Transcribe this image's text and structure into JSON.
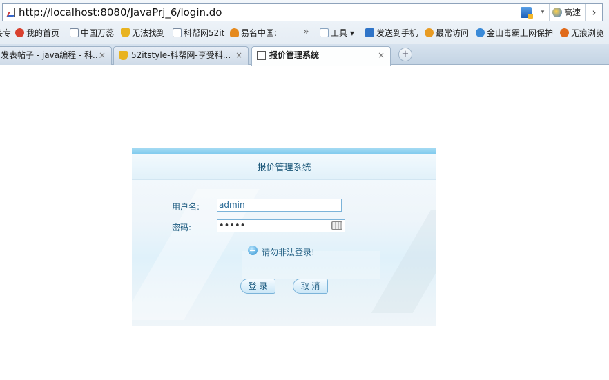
{
  "browser": {
    "url": "http://localhost:8080/JavaPrj_6/login.do",
    "speed_label": "高速",
    "go_glyph": "›",
    "dropdown_glyph": "▾"
  },
  "favorites": [
    {
      "label": "接专",
      "icon": "bookmark-icon",
      "color": "#e9a33a"
    },
    {
      "label": "我的首页",
      "icon": "weibo-icon",
      "color": "#d9412f"
    },
    {
      "label": "中国万蕊",
      "icon": "page-icon",
      "color": "#7a8aa0"
    },
    {
      "label": "无法找到",
      "icon": "trophy-icon",
      "color": "#e8b321"
    },
    {
      "label": "科帮网52it",
      "icon": "page-icon",
      "color": "#7a8aa0"
    },
    {
      "label": "易名中国:",
      "icon": "flame-icon",
      "color": "#e58a1f"
    },
    {
      "label": "»",
      "icon": "",
      "color": ""
    },
    {
      "label": "工具 ▾",
      "icon": "tools-icon",
      "color": "#8aa4c0"
    },
    {
      "label": "发送到手机",
      "icon": "send-icon",
      "color": "#2f74c8"
    },
    {
      "label": "最常访问",
      "icon": "star-icon",
      "color": "#e89b23"
    },
    {
      "label": "金山毒霸上网保护",
      "icon": "shield-icon",
      "color": "#3a8ad8"
    },
    {
      "label": "无痕浏览",
      "icon": "eye-icon",
      "color": "#e06a1a"
    }
  ],
  "tabs": [
    {
      "label": "发表帖子 - java编程 - 科...",
      "close": "×",
      "active": false
    },
    {
      "label": "52itstyle-科帮网-享受科...",
      "close": "×",
      "active": false
    },
    {
      "label": "报价管理系统",
      "close": "×",
      "active": true
    }
  ],
  "newtab_glyph": "+",
  "login": {
    "title": "报价管理系统",
    "username_label": "用户名:",
    "username_value": "admin",
    "password_label": "密码:",
    "password_value": "•••••",
    "warning": "请勿非法登录!",
    "login_button": "登 录",
    "cancel_button": "取 消"
  }
}
